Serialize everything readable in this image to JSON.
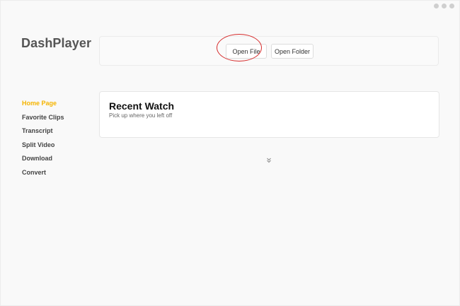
{
  "app": {
    "title": "DashPlayer"
  },
  "window_controls": [
    {
      "name": "minimize",
      "icon": "circle-dot-icon"
    },
    {
      "name": "maximize",
      "icon": "circle-dot-icon"
    },
    {
      "name": "close",
      "icon": "circle-dot-icon"
    }
  ],
  "toolbar": {
    "open_file_label": "Open File",
    "open_folder_label": "Open Folder"
  },
  "sidebar": {
    "items": [
      {
        "label": "Home Page",
        "active": true
      },
      {
        "label": "Favorite Clips",
        "active": false
      },
      {
        "label": "Transcript",
        "active": false
      },
      {
        "label": "Split Video",
        "active": false
      },
      {
        "label": "Download",
        "active": false
      },
      {
        "label": "Convert",
        "active": false
      }
    ]
  },
  "recent": {
    "title": "Recent Watch",
    "subtitle": "Pick up where you left off"
  },
  "colors": {
    "accent": "#f5b400",
    "highlight": "#d62b2b",
    "background": "#f9f9f9"
  },
  "icons": {
    "expand": "double-chevron-down-icon"
  }
}
